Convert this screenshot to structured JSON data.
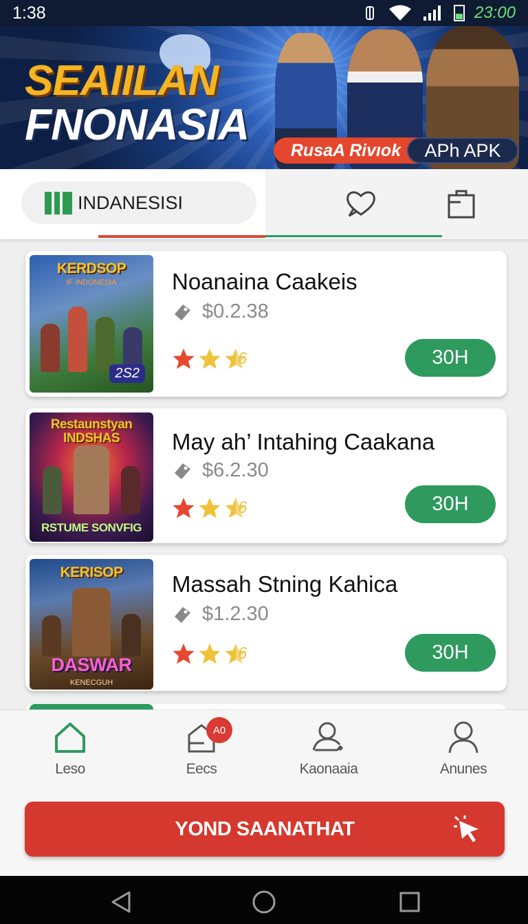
{
  "status_bar": {
    "time": "1:38",
    "battery_text": "23:00"
  },
  "banner": {
    "title_line1": "SEAIILAN",
    "title_line2": "FNONASIA",
    "tag_red": "RusaA Rivıok",
    "tag_dark": "APh  APK"
  },
  "tabs": {
    "region_label": "INDANESISI",
    "favorites_icon": "heart-icon",
    "bag_icon": "shopping-bag-icon",
    "colors": {
      "active_red": "#d84a34",
      "active_green": "#2e9a66"
    }
  },
  "games": [
    {
      "name": "Noanaina Caakeis",
      "price": "$0.2.38",
      "rating_suffix": "6",
      "button_label": "30H",
      "thumb_title": "KERDSOP",
      "thumb_subtitle": "IF INDONESIA",
      "thumb_badge": "2S2"
    },
    {
      "name": "May ah’ Intahing Caakana",
      "price": "$6.2.30",
      "rating_suffix": "6",
      "button_label": "30H",
      "thumb_title": "Restaunstyan INDSHAS",
      "thumb_subtitle": "RSTUME SONVFIG",
      "thumb_badge": ""
    },
    {
      "name": "Massah Stning Kahica",
      "price": "$1.2.30",
      "rating_suffix": "6",
      "button_label": "30H",
      "thumb_title": "KERISOP",
      "thumb_subtitle": "DASWAR",
      "thumb_badge": "KENECGUH"
    }
  ],
  "bottom_nav": [
    {
      "label": "Leso",
      "icon": "home-icon"
    },
    {
      "label": "Eecs",
      "icon": "store-icon",
      "badge": "A0"
    },
    {
      "label": "Kaonaaia",
      "icon": "user-edit-icon"
    },
    {
      "label": "Anunes",
      "icon": "profile-icon"
    }
  ],
  "cta": {
    "label": "YOND SAANATHAT",
    "icon": "cursor-click-icon"
  },
  "system_nav": [
    "back-icon",
    "home-circle-icon",
    "recents-icon"
  ]
}
